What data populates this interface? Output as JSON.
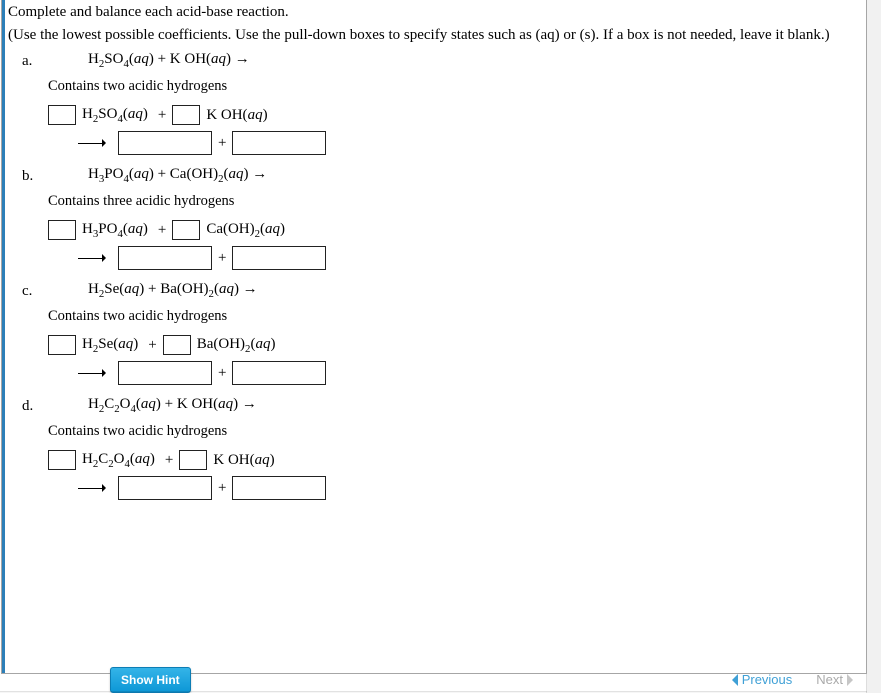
{
  "instructions": {
    "line1": "Complete and balance each acid-base reaction.",
    "line2": "(Use the lowest possible coefficients. Use the pull-down boxes to specify states such as (aq) or (s). If a box is not needed, leave it blank.)"
  },
  "problems": [
    {
      "label": "a.",
      "equation_html": "H<sub>2</sub>SO<sub>4</sub>(<span class='aq'>aq</span>) + K OH(<span class='aq'>aq</span>) →",
      "note": "Contains two acidic hydrogens",
      "reactant1_html": "H<sub>2</sub>SO<sub>4</sub>(<span class='aq'>aq</span>)",
      "reactant2_html": "K OH(<span class='aq'>aq</span>)"
    },
    {
      "label": "b.",
      "equation_html": "H<sub>3</sub>PO<sub>4</sub>(<span class='aq'>aq</span>) + Ca(OH)<sub>2</sub>(<span class='aq'>aq</span>) →",
      "note": "Contains three acidic hydrogens",
      "reactant1_html": "H<sub>3</sub>PO<sub>4</sub>(<span class='aq'>aq</span>)",
      "reactant2_html": "Ca(OH)<sub>2</sub>(<span class='aq'>aq</span>)"
    },
    {
      "label": "c.",
      "equation_html": "H<sub>2</sub>Se(<span class='aq'>aq</span>) + Ba(OH)<sub>2</sub>(<span class='aq'>aq</span>) →",
      "note": "Contains two acidic hydrogens",
      "reactant1_html": "H<sub>2</sub>Se(<span class='aq'>aq</span>)",
      "reactant2_html": "Ba(OH)<sub>2</sub>(<span class='aq'>aq</span>)"
    },
    {
      "label": "d.",
      "equation_html": "H<sub>2</sub>C<sub>2</sub>O<sub>4</sub>(<span class='aq'>aq</span>) + K OH(<span class='aq'>aq</span>) →",
      "note": "Contains two acidic hydrogens",
      "reactant1_html": "H<sub>2</sub>C<sub>2</sub>O<sub>4</sub>(<span class='aq'>aq</span>)",
      "reactant2_html": "K OH(<span class='aq'>aq</span>)"
    }
  ],
  "ui": {
    "plus": "+",
    "hint_label": "Show Hint",
    "prev_label": "Previous",
    "next_label": "Next"
  }
}
